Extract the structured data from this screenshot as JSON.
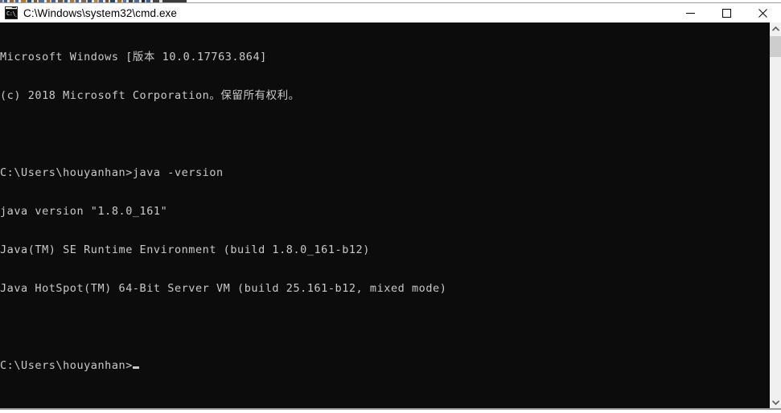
{
  "window": {
    "title": "C:\\Windows\\system32\\cmd.exe",
    "icon": "cmd-console-icon",
    "icon_text": "C:\\_",
    "controls": [
      {
        "name": "minimize-button",
        "label": "Minimize",
        "glyph": "minimize-icon"
      },
      {
        "name": "maximize-button",
        "label": "Maximize",
        "glyph": "maximize-icon"
      },
      {
        "name": "close-button",
        "label": "Close",
        "glyph": "close-icon"
      }
    ]
  },
  "console": {
    "background_color": "#0c0c0c",
    "text_color": "#ccc9c9",
    "lines": [
      "Microsoft Windows [版本 10.0.17763.864]",
      "(c) 2018 Microsoft Corporation。保留所有权利。",
      "",
      "C:\\Users\\houyanhan>java -version",
      "java version \"1.8.0_161\"",
      "Java(TM) SE Runtime Environment (build 1.8.0_161-b12)",
      "Java HotSpot(TM) 64-Bit Server VM (build 25.161-b12, mixed mode)",
      ""
    ],
    "prompt": "C:\\Users\\houyanhan>",
    "cursor": "_"
  },
  "scrollbar": {
    "up_arrow": "chevron-up-icon",
    "down_arrow": "chevron-down-icon",
    "thumb_color": "#cdcdcd",
    "track_color": "#f0f0f0"
  }
}
